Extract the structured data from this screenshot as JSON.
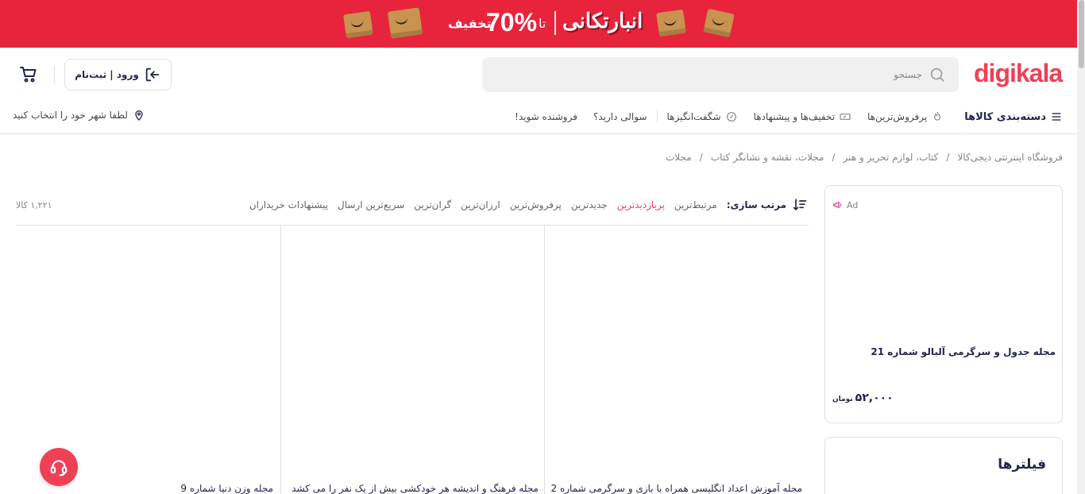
{
  "promo": {
    "brand": "انبارتکانی",
    "upto": "تا",
    "percent": "70%",
    "off": "تخفیف",
    "color": "#e7243b"
  },
  "header": {
    "logo": "digikala",
    "search_placeholder": "جستجو",
    "login_label": "ورود | ثبت‌نام",
    "brand_color": "#ef4056"
  },
  "nav": {
    "categories": "دسته‌بندی کالاها",
    "items": [
      "پرفروش‌ترین‌ها",
      "تخفیف‌ها و پیشنهادها",
      "شگفت‌انگیزها",
      "سوالی دارید؟",
      "فروشنده شوید!"
    ],
    "city": "لطفا شهر خود را انتخاب کنید"
  },
  "breadcrumb": [
    "فروشگاه اینترنتی دیجی‌کالا",
    "کتاب، لوازم تحریر و هنر",
    "مجلات، نقشه و نشانگر کتاب",
    "مجلات"
  ],
  "sort": {
    "label": "مرتب سازی:",
    "options": [
      "مرتبط‌ترین",
      "پربازدیدترین",
      "جدیدترین",
      "پرفروش‌ترین",
      "ارزان‌ترین",
      "گران‌ترین",
      "سریع‌ترین ارسال",
      "پیشنهادات خریداران"
    ],
    "active": "پربازدیدترین",
    "count": "۱,۲۲۱ کالا"
  },
  "products": [
    "مجله آموزش اعداد انگلیسی همراه با بازی و سرگرمی شماره 2",
    "مجله فرهنگ و اندیشه هر خودکشی بیش از یک نفر را می کشد",
    "مجله وزن دنیا شماره 9"
  ],
  "ad": {
    "badge": "Ad",
    "title": "مجله جدول و سرگرمی آلبالو شماره 21",
    "price": "۵۲,۰۰۰",
    "currency": "تومان"
  },
  "filters": {
    "title": "فیلترها"
  }
}
